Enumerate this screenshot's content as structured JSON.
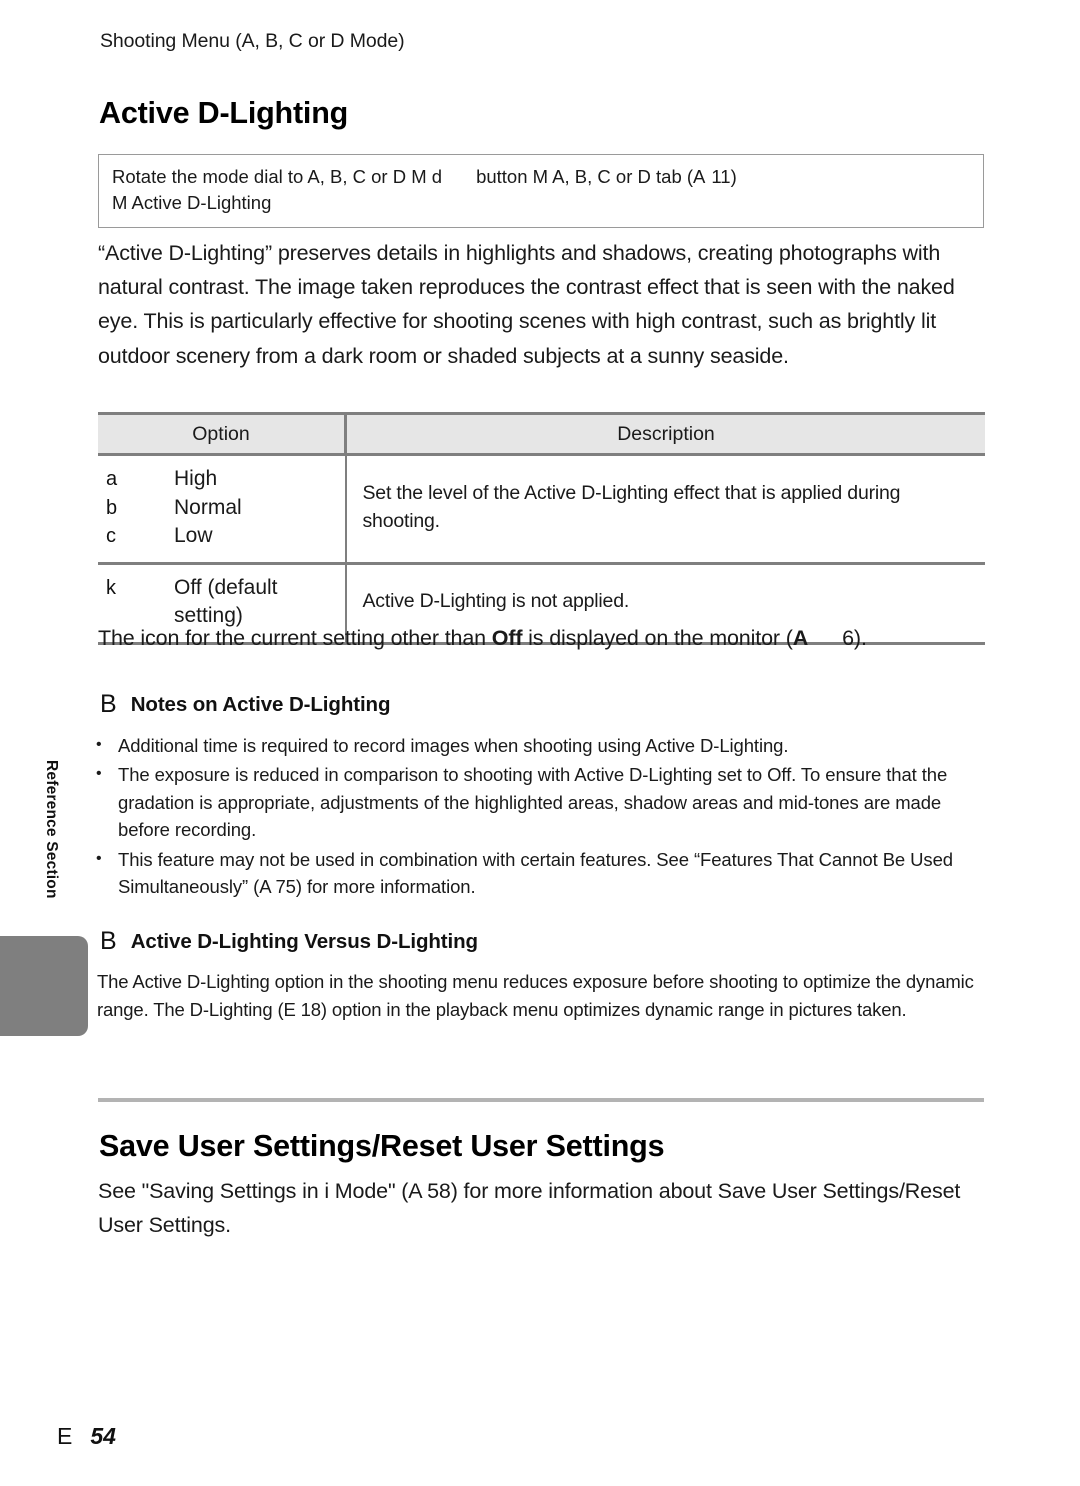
{
  "page": {
    "running_head": "Shooting Menu (A, B, C  or D  Mode)",
    "footer_marker": "E",
    "footer_number": "54",
    "side_label": "Reference Section"
  },
  "section1": {
    "title": "Active D-Lighting",
    "path_box": {
      "line1_a": "Rotate the mode dial to A, B, C  or D  M  d",
      "line1_b": "button M  A, B, C  or D  tab (A",
      "line1_c": "11)",
      "line2": "M  Active D-Lighting"
    },
    "intro": "“Active D-Lighting” preserves details in highlights and shadows, creating photographs with natural contrast. The image taken reproduces the contrast effect that is seen with the naked eye. This is particularly effective for shooting scenes with high contrast, such as brightly lit outdoor scenery from a dark room or shaded subjects at a sunny seaside.",
    "table": {
      "headers": [
        "Option",
        "Description"
      ],
      "rows": [
        {
          "options": [
            {
              "glyph": "a",
              "label": "High"
            },
            {
              "glyph": "b",
              "label": "Normal"
            },
            {
              "glyph": "c",
              "label": "Low"
            }
          ],
          "description": "Set the level of the Active D-Lighting effect that is applied during shooting."
        },
        {
          "options": [
            {
              "glyph": "k",
              "label": "Off (default setting)"
            }
          ],
          "description": "Active D-Lighting is not applied."
        }
      ]
    },
    "after_table_a": "The icon for the current setting other than ",
    "after_table_b": "Off",
    "after_table_c": " is displayed on the monitor (",
    "after_table_d": "A",
    "after_table_e": "6).",
    "tip1": {
      "marker": "B",
      "title": "Notes on Active D-Lighting",
      "bullets": [
        "Additional time is required to record images when shooting using Active D-Lighting.",
        "The exposure is reduced in comparison to shooting with Active D-Lighting set to Off. To ensure that the gradation is appropriate, adjustments of the highlighted areas, shadow areas and mid-tones are made before recording.",
        "This feature may not be used in combination with certain features. See “Features That Cannot Be Used Simultaneously” (A  75) for more information."
      ]
    },
    "tip2": {
      "marker": "B",
      "title": "Active D-Lighting Versus D-Lighting",
      "paragraph": "The Active D-Lighting option in the shooting menu reduces exposure before shooting to optimize the dynamic range. The D-Lighting (E  18) option in the playback menu optimizes dynamic range in pictures taken."
    }
  },
  "section2": {
    "title": "Save User Settings/Reset User Settings",
    "paragraph": "See \"Saving Settings in i  Mode\" (A  58) for more information about Save User Settings/Reset User Settings."
  },
  "colors": {
    "table_header_bg": "#e6e6e6",
    "rule": "#b3b3b3",
    "tab": "#7f7f7f",
    "border": "#7f7f7f"
  }
}
